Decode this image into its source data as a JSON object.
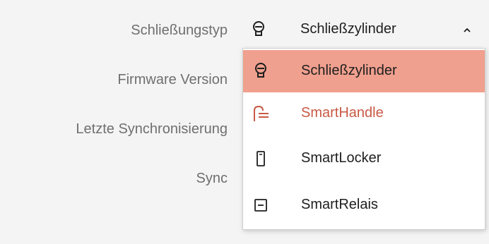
{
  "labels": {
    "lock_type": "Schließungstyp",
    "firmware_version": "Firmware Version",
    "last_sync": "Letzte Synchronisierung",
    "sync": "Sync"
  },
  "lock_type_select": {
    "selected": "Schließzylinder",
    "icon": "cylinder-lock-icon",
    "expanded": true
  },
  "options": [
    {
      "label": "Schließzylinder",
      "icon": "cylinder-lock-icon",
      "state": "selected"
    },
    {
      "label": "SmartHandle",
      "icon": "smarthandle-icon",
      "state": "hover"
    },
    {
      "label": "SmartLocker",
      "icon": "smartlocker-icon",
      "state": "normal"
    },
    {
      "label": "SmartRelais",
      "icon": "smartrelais-icon",
      "state": "normal"
    }
  ],
  "colors": {
    "selected_bg": "#f0a08e",
    "accent": "#c85a45",
    "label_text": "#6f6f6f"
  }
}
